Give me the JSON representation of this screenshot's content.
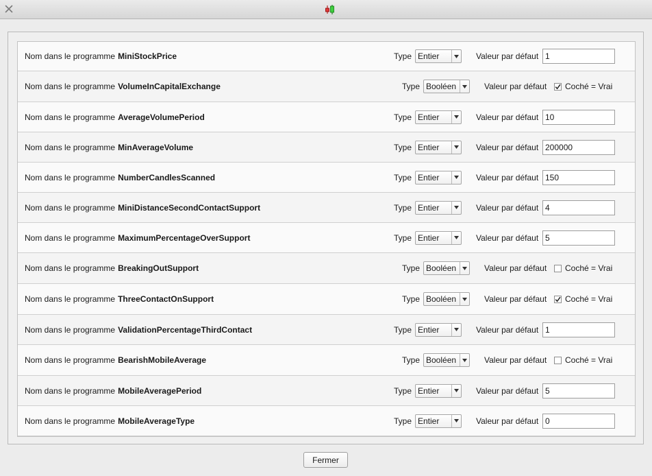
{
  "window": {
    "close_icon": "close-x-icon",
    "app_icon": "candlestick-icon"
  },
  "labels": {
    "name_prefix": "Nom dans le programme",
    "type": "Type",
    "default_value": "Valeur par défaut",
    "checked_true": "Coché = Vrai"
  },
  "rows": [
    {
      "name": "MiniStockPrice",
      "type": "Entier",
      "value": "1"
    },
    {
      "name": "VolumeInCapitalExchange",
      "type": "Booléen",
      "checked": true
    },
    {
      "name": "AverageVolumePeriod",
      "type": "Entier",
      "value": "10"
    },
    {
      "name": "MinAverageVolume",
      "type": "Entier",
      "value": "200000"
    },
    {
      "name": "NumberCandlesScanned",
      "type": "Entier",
      "value": "150"
    },
    {
      "name": "MiniDistanceSecondContactSupport",
      "type": "Entier",
      "value": "4"
    },
    {
      "name": "MaximumPercentageOverSupport",
      "type": "Entier",
      "value": "5"
    },
    {
      "name": "BreakingOutSupport",
      "type": "Booléen",
      "checked": false
    },
    {
      "name": "ThreeContactOnSupport",
      "type": "Booléen",
      "checked": true
    },
    {
      "name": "ValidationPercentageThirdContact",
      "type": "Entier",
      "value": "1"
    },
    {
      "name": "BearishMobileAverage",
      "type": "Booléen",
      "checked": false
    },
    {
      "name": "MobileAveragePeriod",
      "type": "Entier",
      "value": "5"
    },
    {
      "name": "MobileAverageType",
      "type": "Entier",
      "value": "0"
    }
  ],
  "footer": {
    "close_label": "Fermer"
  }
}
